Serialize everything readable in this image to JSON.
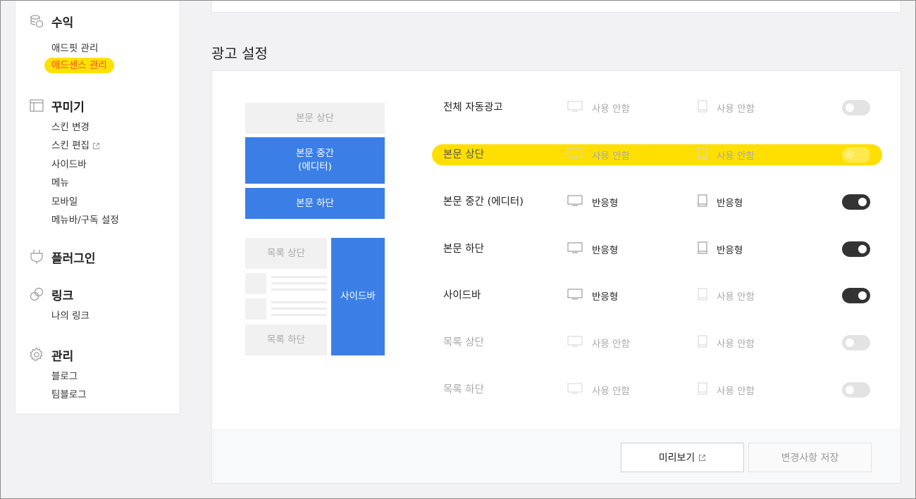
{
  "sidebar": {
    "sections": [
      {
        "title": "수익",
        "icon": "coins-icon",
        "items": [
          "애드핏 관리",
          "애드센스 관리"
        ]
      },
      {
        "title": "꾸미기",
        "icon": "layout-icon",
        "items": [
          "스킨 변경",
          "스킨 편집",
          "사이드바",
          "메뉴",
          "모바일",
          "메뉴바/구독 설정"
        ]
      },
      {
        "title": "플러그인",
        "icon": "plug-icon",
        "items": []
      },
      {
        "title": "링크",
        "icon": "link-icon",
        "items": [
          "나의 링크"
        ]
      },
      {
        "title": "관리",
        "icon": "gear-icon",
        "items": [
          "블로그",
          "팀블로그"
        ]
      }
    ],
    "highlight_color": "#ffe100",
    "highlight_text_color": "#ff4d2a"
  },
  "main": {
    "heading": "광고 설정",
    "diagram": {
      "body_top": "본문 상단",
      "body_middle_line1": "본문 중간",
      "body_middle_line2": "(에디터)",
      "body_bottom": "본문 하단",
      "list_top": "목록 상단",
      "list_bottom": "목록 하단",
      "sidebar": "사이드바"
    },
    "rows": [
      {
        "label": "전체 자동광고",
        "pc": "사용 안함",
        "mobile": "사용 안함",
        "enabled": false,
        "highlighted": false
      },
      {
        "label": "본문 상단",
        "pc": "사용 안함",
        "mobile": "사용 안함",
        "enabled": false,
        "highlighted": true
      },
      {
        "label": "본문 중간 (에디터)",
        "pc": "반응형",
        "mobile": "반응형",
        "enabled": true,
        "highlighted": false
      },
      {
        "label": "본문 하단",
        "pc": "반응형",
        "mobile": "반응형",
        "enabled": true,
        "highlighted": false
      },
      {
        "label": "사이드바",
        "pc": "반응형",
        "mobile": "사용 안함",
        "enabled": true,
        "highlighted": false
      },
      {
        "label": "목록 상단",
        "pc": "사용 안함",
        "mobile": "사용 안함",
        "enabled": false,
        "highlighted": false
      },
      {
        "label": "목록 하단",
        "pc": "사용 안함",
        "mobile": "사용 안함",
        "enabled": false,
        "highlighted": false
      }
    ],
    "buttons": {
      "preview": "미리보기",
      "save": "변경사항 저장"
    },
    "accent_color": "#3b7fe6",
    "row_highlight_color": "#ffdf00"
  }
}
